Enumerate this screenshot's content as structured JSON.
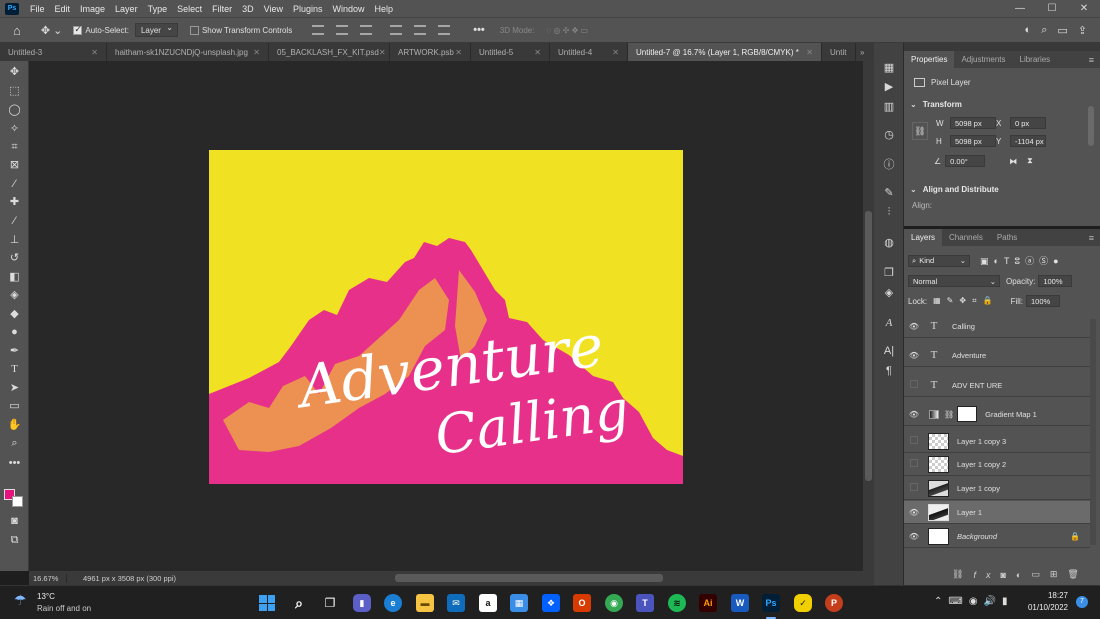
{
  "app": {
    "logo": "Ps"
  },
  "menu": [
    "File",
    "Edit",
    "Image",
    "Layer",
    "Type",
    "Select",
    "Filter",
    "3D",
    "View",
    "Plugins",
    "Window",
    "Help"
  ],
  "window_controls": {
    "minimize": "—",
    "maximize": "☐",
    "close": "✕"
  },
  "options_bar": {
    "auto_select_label": "Auto-Select:",
    "auto_select_target": "Layer",
    "show_transform_label": "Show Transform Controls",
    "more": "•••",
    "mode_3d_label": "3D Mode:"
  },
  "tabs": [
    {
      "label": "Untitled-3",
      "close": "✕"
    },
    {
      "label": "haitham-sk1NZUCNDjQ-unsplash.jpg",
      "close": "✕"
    },
    {
      "label": "05_BACKLASH_FX_KIT.psd",
      "close": "✕"
    },
    {
      "label": "ARTWORK.psb",
      "close": "✕"
    },
    {
      "label": "Untitled-5",
      "close": "✕"
    },
    {
      "label": "Untitled-4",
      "close": "✕"
    },
    {
      "label": "Untitled-7 @ 16.7% (Layer 1, RGB/8/CMYK) *",
      "close": "✕"
    },
    {
      "label": "Untit",
      "close": ""
    }
  ],
  "tab_overflow": "»",
  "artwork": {
    "title_line1": "Adventure",
    "title_line2": "Calling",
    "colors": {
      "background": "#f1e123",
      "mountain": "#e6308a",
      "text": "#ffffff"
    }
  },
  "status": {
    "zoom": "16.67%",
    "doc_info": "4961 px x 3508 px (300 ppi)"
  },
  "properties_panel": {
    "tabs": [
      "Properties",
      "Adjustments",
      "Libraries"
    ],
    "layer_type": "Pixel Layer",
    "transform_title": "Transform",
    "w_label": "W",
    "w_value": "5098 px",
    "h_label": "H",
    "h_value": "5098 px",
    "x_label": "X",
    "x_value": "0 px",
    "y_label": "Y",
    "y_value": "-1104 px",
    "angle_value": "0.00°",
    "align_title": "Align and Distribute",
    "align_label": "Align:"
  },
  "layers_panel": {
    "tabs": [
      "Layers",
      "Channels",
      "Paths"
    ],
    "filter_kind": "Kind",
    "blend_mode": "Normal",
    "opacity_label": "Opacity:",
    "opacity_value": "100%",
    "lock_label": "Lock:",
    "fill_label": "Fill:",
    "fill_value": "100%",
    "layers": [
      {
        "name": "Calling",
        "kind": "text",
        "visible": true
      },
      {
        "name": "Adventure",
        "kind": "text",
        "visible": true
      },
      {
        "name": "ADV ENT URE",
        "kind": "text",
        "visible": false
      },
      {
        "name": "Gradient Map 1",
        "kind": "adjustment",
        "visible": true
      },
      {
        "name": "Layer 1 copy 3",
        "kind": "pixel",
        "visible": false
      },
      {
        "name": "Layer 1 copy 2",
        "kind": "pixel",
        "visible": false
      },
      {
        "name": "Layer 1 copy",
        "kind": "pixel",
        "visible": false
      },
      {
        "name": "Layer 1",
        "kind": "pixel",
        "visible": true,
        "selected": true
      },
      {
        "name": "Background",
        "kind": "background",
        "visible": true,
        "locked": true
      }
    ]
  },
  "taskbar": {
    "weather_temp": "13°C",
    "weather_text": "Rain off and on",
    "time": "18:27",
    "date": "01/10/2022",
    "notifications": "7"
  }
}
